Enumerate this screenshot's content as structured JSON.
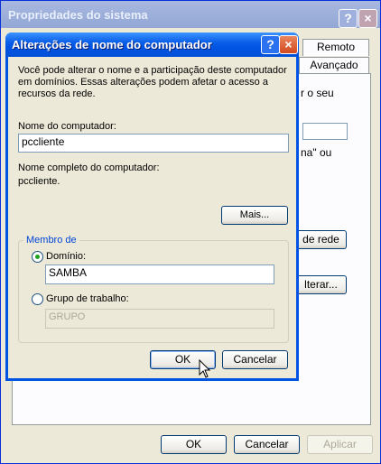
{
  "background_window": {
    "title": "Propriedades do sistema",
    "help_label": "?",
    "close_label": "×",
    "tabs": [
      "Remoto",
      "Avançado"
    ],
    "partial_texts": [
      "r o seu",
      "na\" ou"
    ],
    "rede_button_label": "de rede",
    "alterar_button_label": "lterar...",
    "buttons": {
      "ok": "OK",
      "cancel": "Cancelar",
      "apply": "Aplicar"
    }
  },
  "dialog": {
    "title": "Alterações de nome do computador",
    "help_label": "?",
    "close_label": "×",
    "description": "Você pode alterar o nome e a participação deste computador em domínios. Essas alterações podem afetar o acesso a recursos da rede.",
    "computer_name_label": "Nome do computador:",
    "computer_name_value": "pccliente",
    "full_name_label": "Nome completo do computador:",
    "full_name_value": "pccliente.",
    "more_button": "Mais...",
    "member_group": {
      "legend": "Membro de",
      "domain_label": "Domínio:",
      "domain_value": "SAMBA",
      "workgroup_label": "Grupo de trabalho:",
      "workgroup_value": "GRUPO",
      "selected": "domain"
    },
    "buttons": {
      "ok": "OK",
      "cancel": "Cancelar"
    }
  }
}
